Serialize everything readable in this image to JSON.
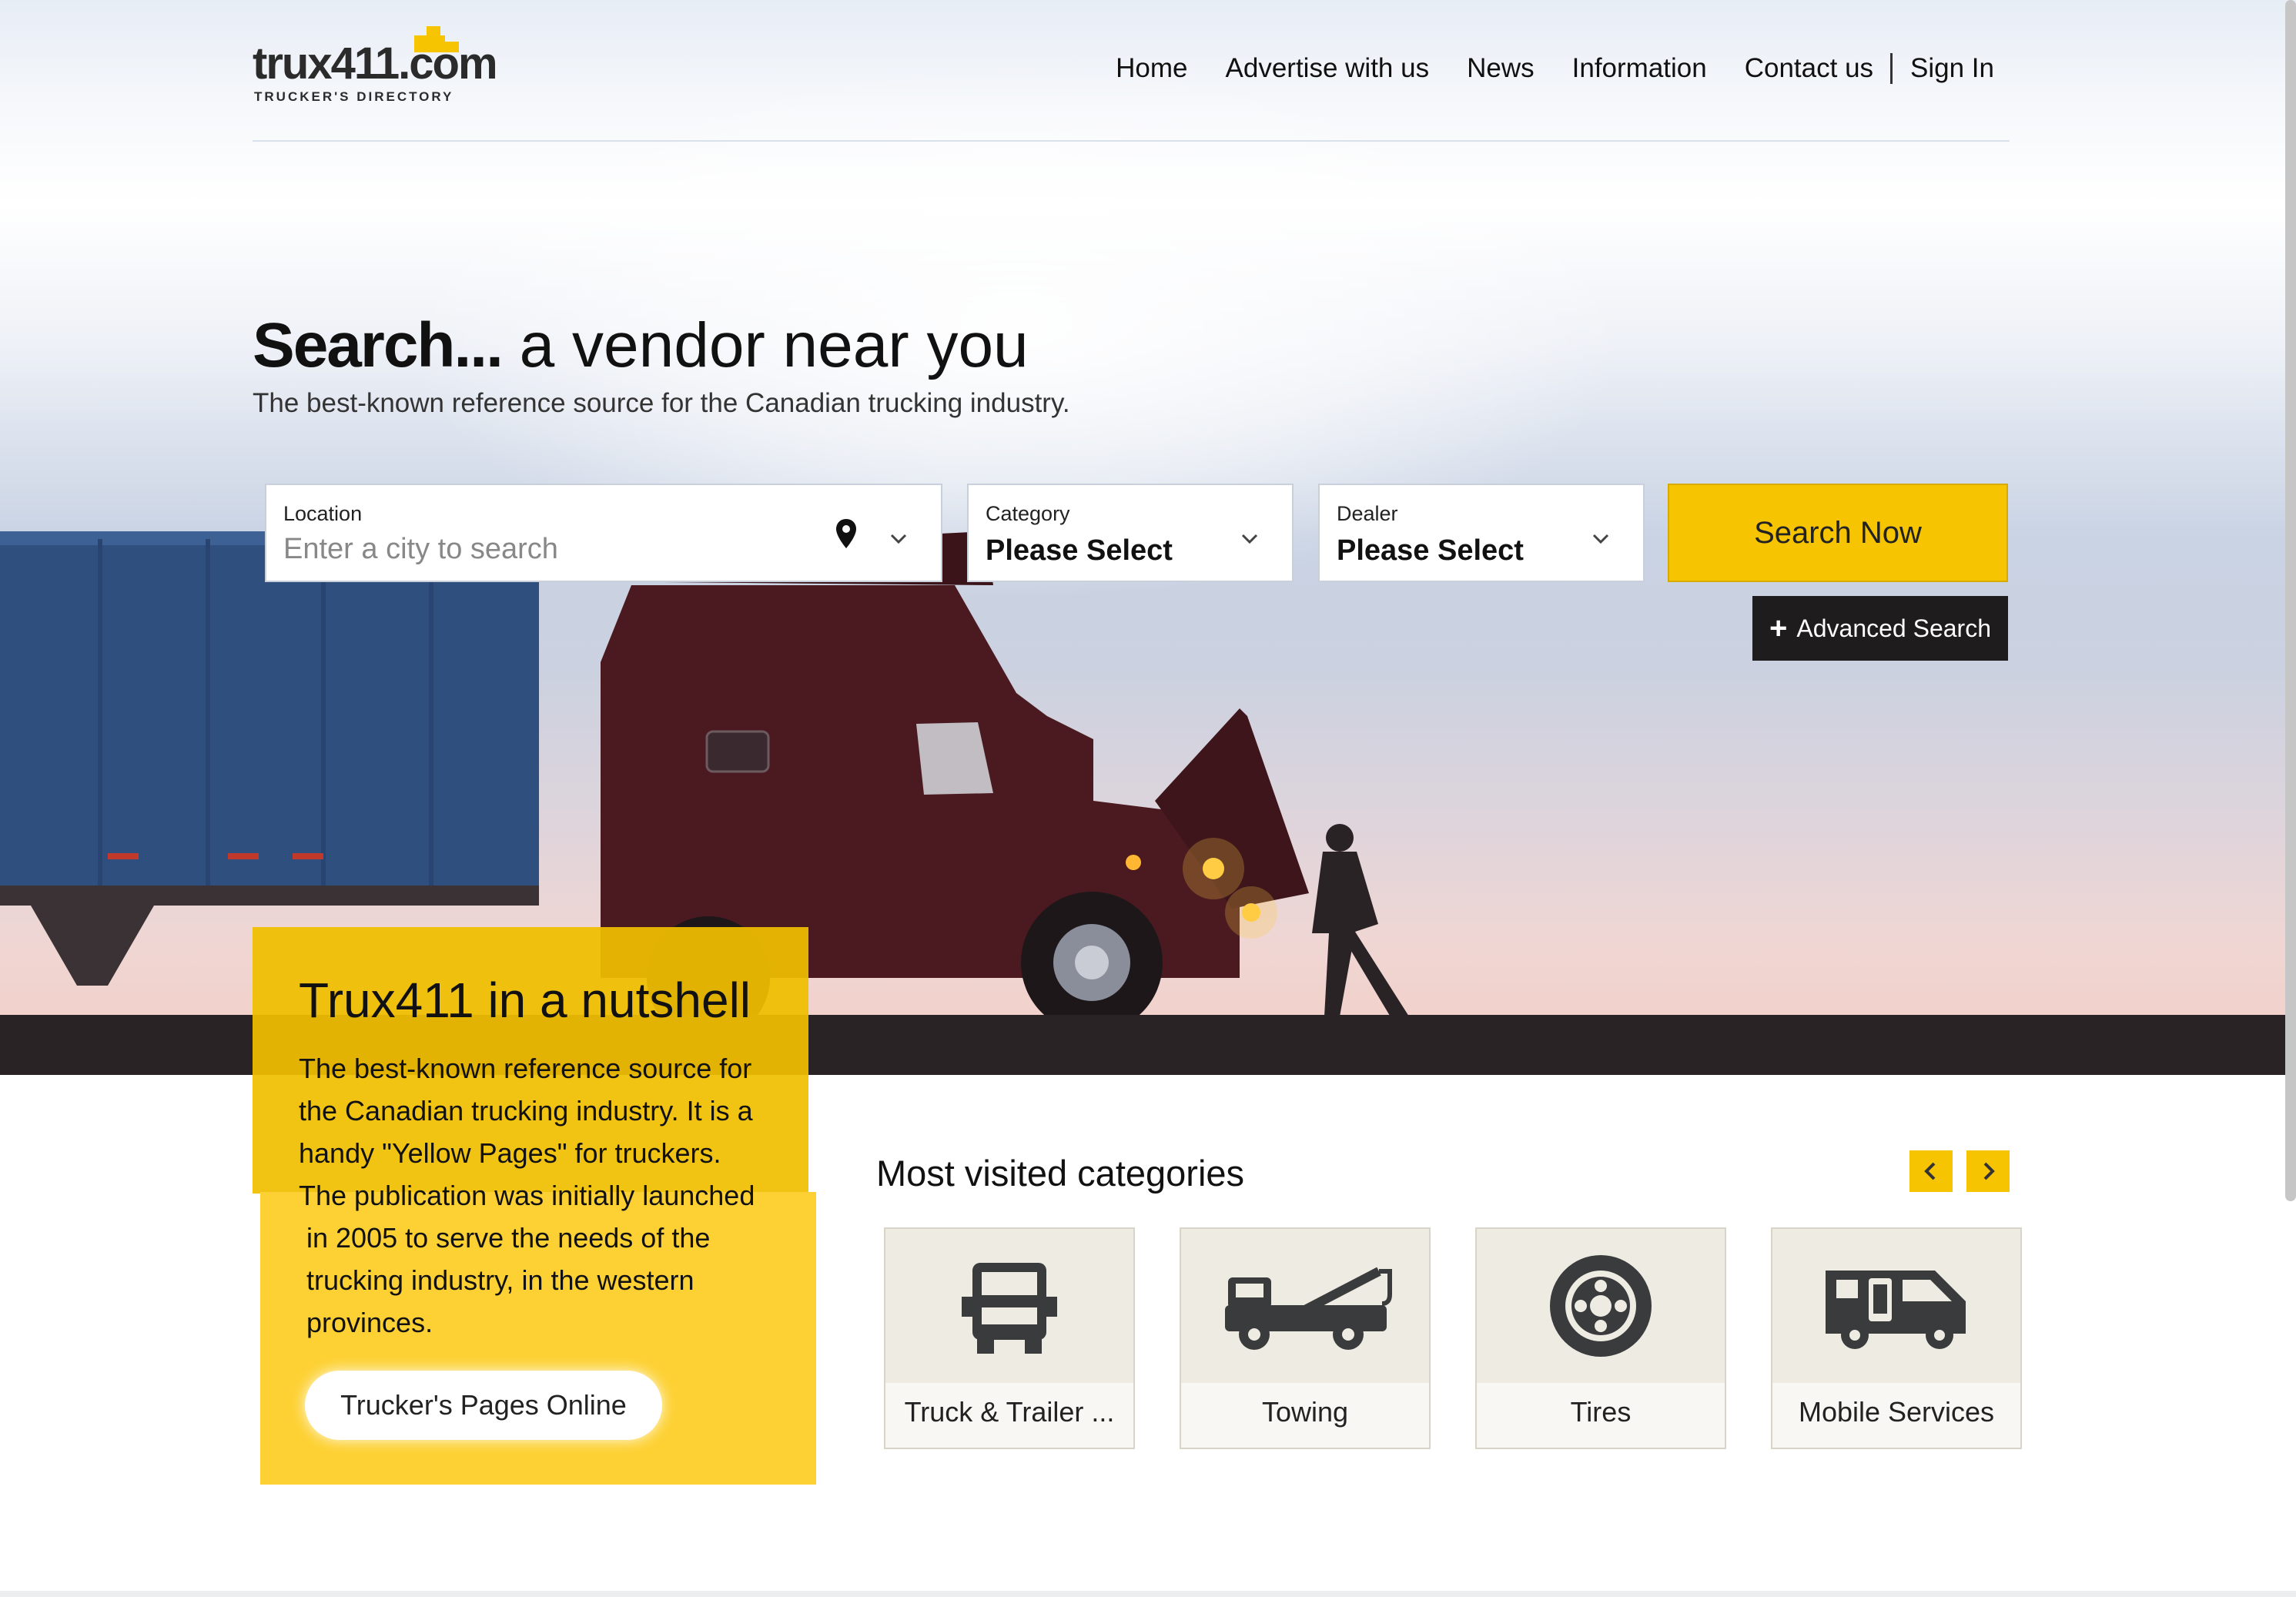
{
  "brand": {
    "logo_text": "trux411.com",
    "logo_tagline": "TRUCKER'S DIRECTORY"
  },
  "nav": {
    "items": [
      {
        "label": "Home"
      },
      {
        "label": "Advertise with us"
      },
      {
        "label": "News"
      },
      {
        "label": "Information"
      },
      {
        "label": "Contact us"
      }
    ],
    "sign_in": "Sign In"
  },
  "hero": {
    "headline_bold": "Search...",
    "headline_light": " a vendor near you",
    "subheadline": "The best-known reference source for the Canadian trucking industry."
  },
  "search": {
    "location_label": "Location",
    "location_placeholder": "Enter a city to search",
    "category_label": "Category",
    "category_value": "Please Select",
    "dealer_label": "Dealer",
    "dealer_value": "Please Select",
    "search_button": "Search Now",
    "advanced_button": "Advanced Search"
  },
  "nutshell": {
    "title": "Trux411 in a nutshell",
    "text_lines": [
      "The best-known reference source for",
      "the Canadian trucking industry. It is a",
      "handy \"Yellow Pages\" for truckers.",
      "The publication was initially launched",
      "in 2005 to serve the needs of the",
      "trucking industry, in the western",
      "provinces."
    ],
    "button": "Trucker's Pages Online"
  },
  "categories": {
    "title": "Most visited categories",
    "items": [
      {
        "label": "Truck & Trailer ...",
        "icon": "truck-front-icon"
      },
      {
        "label": "Towing",
        "icon": "tow-truck-icon"
      },
      {
        "label": "Tires",
        "icon": "tire-icon"
      },
      {
        "label": "Mobile Services",
        "icon": "mobile-service-van-icon"
      }
    ]
  },
  "colors": {
    "accent_yellow": "#f6c400",
    "dark_button": "#1e1c1c",
    "truck_red": "#4a1a20",
    "trailer_blue": "#2f4f7e"
  }
}
